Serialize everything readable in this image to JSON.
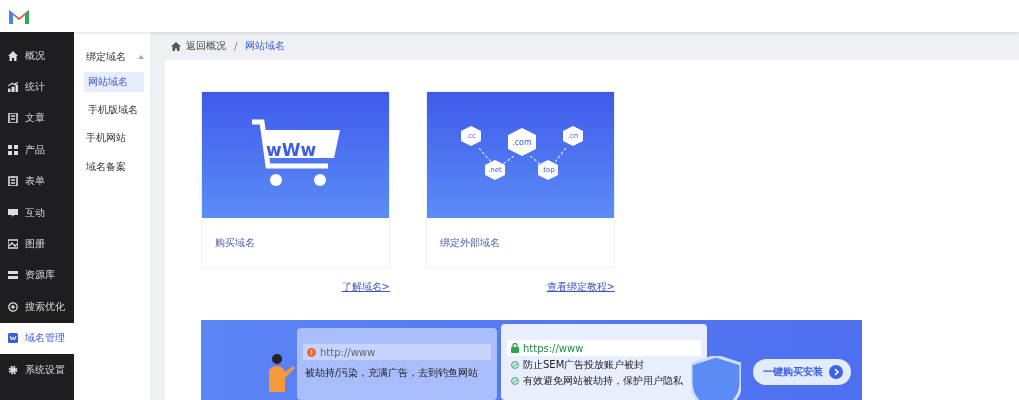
{
  "sidebar": {
    "items": [
      {
        "label": "概况",
        "selected": false
      },
      {
        "label": "统计",
        "selected": false
      },
      {
        "label": "文章",
        "selected": false
      },
      {
        "label": "产品",
        "selected": false
      },
      {
        "label": "表单",
        "selected": false
      },
      {
        "label": "互动",
        "selected": false
      },
      {
        "label": "图册",
        "selected": false
      },
      {
        "label": "资源库",
        "selected": false
      },
      {
        "label": "搜索优化",
        "selected": false
      },
      {
        "label": "域名管理",
        "selected": true
      },
      {
        "label": "系统设置",
        "selected": false
      }
    ]
  },
  "subnav": {
    "items": [
      {
        "label": "绑定域名",
        "expanded": true,
        "children": [
          {
            "label": "网站域名",
            "selected": true
          },
          {
            "label": "手机版域名",
            "selected": false
          }
        ]
      },
      {
        "label": "手机网站",
        "selected": false
      },
      {
        "label": "域名备案",
        "selected": false
      }
    ]
  },
  "breadcrumb": {
    "back": "返回概况",
    "separator": "/",
    "current": "网站域名"
  },
  "cards": [
    {
      "kind": "cart",
      "art_text": "wWw",
      "title": "购买域名",
      "link": "了解域名>"
    },
    {
      "kind": "domains",
      "art_labels": [
        ".cc",
        ".com",
        ".cn",
        ".net",
        ".top"
      ],
      "title": "绑定外部域名",
      "link": "查看绑定教程>"
    }
  ],
  "banner": {
    "bad_url": "http://www",
    "bad_note": "被劫持/污染，充满广告，去到钓鱼网站",
    "good_url": "https://www",
    "good_points": [
      "防止SEM广告投放账户被封",
      "有效避免网站被劫持，保护用户隐私"
    ],
    "button": "一键购买安装"
  }
}
